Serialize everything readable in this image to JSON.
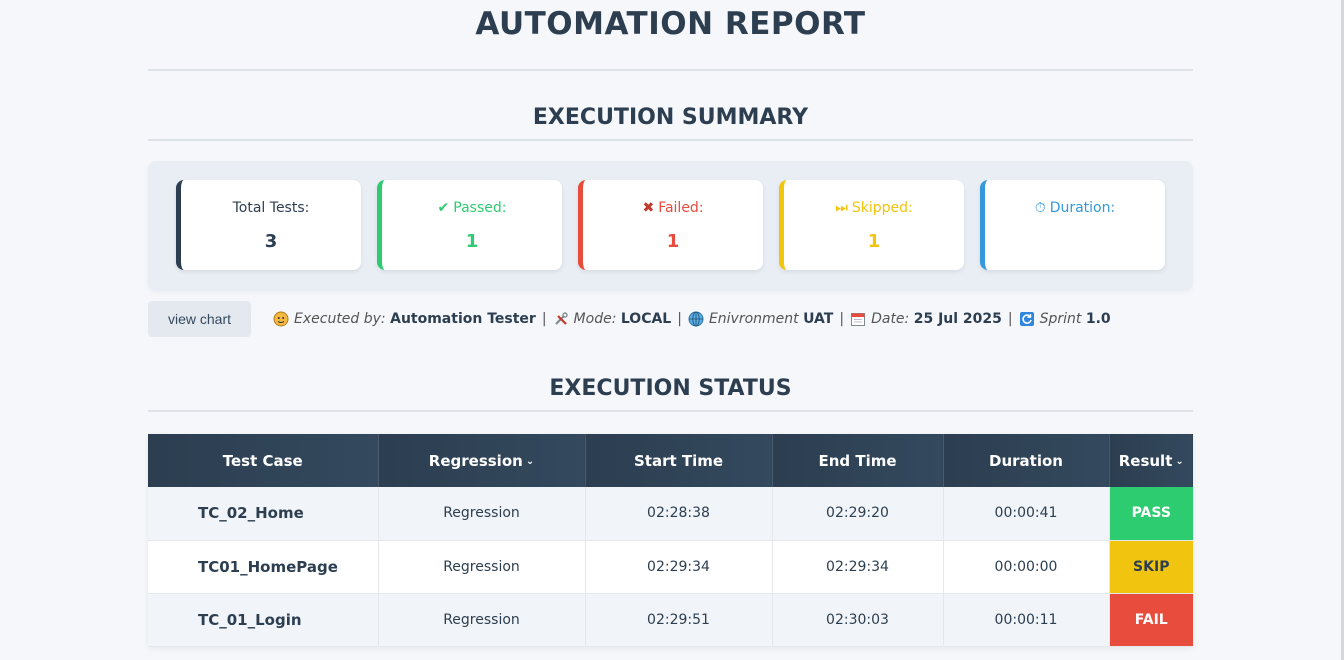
{
  "header": {
    "title": "AUTOMATION REPORT"
  },
  "summary": {
    "title": "EXECUTION SUMMARY",
    "cards": {
      "total": {
        "label": "Total Tests:",
        "value": "3"
      },
      "passed": {
        "icon": "checkmark-icon",
        "label": "Passed:",
        "value": "1"
      },
      "failed": {
        "icon": "cross-icon",
        "label": "Failed:",
        "value": "1"
      },
      "skipped": {
        "icon": "skip-forward-icon",
        "label": "Skipped:",
        "value": "1"
      },
      "duration": {
        "icon": "stopwatch-icon",
        "label": "Duration:",
        "value": ""
      }
    },
    "colors": {
      "passed": "#2ecc71",
      "failed": "#e74c3c",
      "skipped": "#f1c40f",
      "duration": "#3498db",
      "total": "#2c3e50"
    }
  },
  "meta": {
    "view_chart_label": "view chart",
    "executed_by": {
      "icon": "person-icon",
      "label": "Executed by:",
      "value": "Automation Tester"
    },
    "mode": {
      "icon": "tools-icon",
      "label": "Mode:",
      "value": "LOCAL"
    },
    "environment": {
      "icon": "globe-icon",
      "label": "Enivronment",
      "value": "UAT"
    },
    "date": {
      "icon": "calendar-icon",
      "label": "Date:",
      "value": "25 Jul 2025"
    },
    "sprint": {
      "icon": "refresh-icon",
      "label": "Sprint",
      "value": "1.0"
    }
  },
  "status": {
    "title": "EXECUTION STATUS",
    "columns": [
      "Test Case",
      "Regression",
      "Start Time",
      "End Time",
      "Duration",
      "Result"
    ],
    "rows": [
      {
        "test_case": "TC_02_Home",
        "regression": "Regression",
        "start": "02:28:38",
        "end": "02:29:20",
        "duration": "00:00:41",
        "result": "PASS"
      },
      {
        "test_case": "TC01_HomePage",
        "regression": "Regression",
        "start": "02:29:34",
        "end": "02:29:34",
        "duration": "00:00:00",
        "result": "SKIP"
      },
      {
        "test_case": "TC_01_Login",
        "regression": "Regression",
        "start": "02:29:51",
        "end": "02:30:03",
        "duration": "00:00:11",
        "result": "FAIL"
      }
    ]
  }
}
